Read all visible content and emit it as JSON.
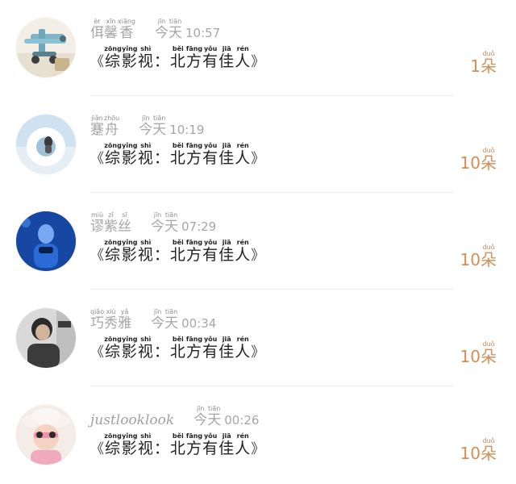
{
  "comments": [
    {
      "nickname": [
        {
          "char": "佴",
          "pinyin": "èr"
        },
        {
          "char": "馨",
          "pinyin": "xīn"
        },
        {
          "char": "香",
          "pinyin": "xiāng"
        }
      ],
      "nickname_latin": "",
      "time_word": [
        {
          "char": "今",
          "pinyin": "jīn"
        },
        {
          "char": "天",
          "pinyin": "tiān"
        }
      ],
      "time": "10:57",
      "gift_open": "《",
      "gift_chars": [
        {
          "char": "综",
          "pinyin": "zōng"
        },
        {
          "char": "影",
          "pinyin": "yǐng"
        },
        {
          "char": "视",
          "pinyin": "shì"
        },
        {
          "char": "：",
          "pinyin": ""
        },
        {
          "char": "北",
          "pinyin": "běi"
        },
        {
          "char": "方",
          "pinyin": "fāng"
        },
        {
          "char": "有",
          "pinyin": "yǒu"
        },
        {
          "char": "佳",
          "pinyin": "jiā"
        },
        {
          "char": "人",
          "pinyin": "rén"
        }
      ],
      "gift_close": "》",
      "count_num": "1",
      "count_unit": "朵",
      "count_unit_pinyin": "duǒ",
      "avatar_icon": "airplane-toy-icon"
    },
    {
      "nickname": [
        {
          "char": "蹇",
          "pinyin": "jiǎn"
        },
        {
          "char": "舟",
          "pinyin": "zhōu"
        }
      ],
      "nickname_latin": "",
      "time_word": [
        {
          "char": "今",
          "pinyin": "jīn"
        },
        {
          "char": "天",
          "pinyin": "tiān"
        }
      ],
      "time": "10:19",
      "gift_open": "《",
      "gift_chars": [
        {
          "char": "综",
          "pinyin": "zōng"
        },
        {
          "char": "影",
          "pinyin": "yǐng"
        },
        {
          "char": "视",
          "pinyin": "shì"
        },
        {
          "char": "：",
          "pinyin": ""
        },
        {
          "char": "北",
          "pinyin": "běi"
        },
        {
          "char": "方",
          "pinyin": "fāng"
        },
        {
          "char": "有",
          "pinyin": "yǒu"
        },
        {
          "char": "佳",
          "pinyin": "jiā"
        },
        {
          "char": "人",
          "pinyin": "rén"
        }
      ],
      "gift_close": "》",
      "count_num": "10",
      "count_unit": "朵",
      "count_unit_pinyin": "duǒ",
      "avatar_icon": "swim-ring-icon"
    },
    {
      "nickname": [
        {
          "char": "谬",
          "pinyin": "miù"
        },
        {
          "char": "紫",
          "pinyin": "zǐ"
        },
        {
          "char": "丝",
          "pinyin": "sī"
        }
      ],
      "nickname_latin": "",
      "time_word": [
        {
          "char": "今",
          "pinyin": "jīn"
        },
        {
          "char": "天",
          "pinyin": "tiān"
        }
      ],
      "time": "07:29",
      "gift_open": "《",
      "gift_chars": [
        {
          "char": "综",
          "pinyin": "zōng"
        },
        {
          "char": "影",
          "pinyin": "yǐng"
        },
        {
          "char": "视",
          "pinyin": "shì"
        },
        {
          "char": "：",
          "pinyin": ""
        },
        {
          "char": "北",
          "pinyin": "běi"
        },
        {
          "char": "方",
          "pinyin": "fāng"
        },
        {
          "char": "有",
          "pinyin": "yǒu"
        },
        {
          "char": "佳",
          "pinyin": "jiā"
        },
        {
          "char": "人",
          "pinyin": "rén"
        }
      ],
      "gift_close": "》",
      "count_num": "10",
      "count_unit": "朵",
      "count_unit_pinyin": "duǒ",
      "avatar_icon": "blue-portrait-icon"
    },
    {
      "nickname": [
        {
          "char": "巧",
          "pinyin": "qiǎo"
        },
        {
          "char": "秀",
          "pinyin": "xiù"
        },
        {
          "char": "雅",
          "pinyin": "yǎ"
        }
      ],
      "nickname_latin": "",
      "time_word": [
        {
          "char": "今",
          "pinyin": "jīn"
        },
        {
          "char": "天",
          "pinyin": "tiān"
        }
      ],
      "time": "00:34",
      "gift_open": "《",
      "gift_chars": [
        {
          "char": "综",
          "pinyin": "zōng"
        },
        {
          "char": "影",
          "pinyin": "yǐng"
        },
        {
          "char": "视",
          "pinyin": "shì"
        },
        {
          "char": "：",
          "pinyin": ""
        },
        {
          "char": "北",
          "pinyin": "běi"
        },
        {
          "char": "方",
          "pinyin": "fāng"
        },
        {
          "char": "有",
          "pinyin": "yǒu"
        },
        {
          "char": "佳",
          "pinyin": "jiā"
        },
        {
          "char": "人",
          "pinyin": "rén"
        }
      ],
      "gift_close": "》",
      "count_num": "10",
      "count_unit": "朵",
      "count_unit_pinyin": "duǒ",
      "avatar_icon": "person-portrait-icon"
    },
    {
      "nickname": [],
      "nickname_latin": "justlooklook",
      "time_word": [
        {
          "char": "今",
          "pinyin": "jīn"
        },
        {
          "char": "天",
          "pinyin": "tiān"
        }
      ],
      "time": "00:26",
      "gift_open": "《",
      "gift_chars": [
        {
          "char": "综",
          "pinyin": "zōng"
        },
        {
          "char": "影",
          "pinyin": "yǐng"
        },
        {
          "char": "视",
          "pinyin": "shì"
        },
        {
          "char": "：",
          "pinyin": ""
        },
        {
          "char": "北",
          "pinyin": "běi"
        },
        {
          "char": "方",
          "pinyin": "fāng"
        },
        {
          "char": "有",
          "pinyin": "yǒu"
        },
        {
          "char": "佳",
          "pinyin": "jiā"
        },
        {
          "char": "人",
          "pinyin": "rén"
        }
      ],
      "gift_close": "》",
      "count_num": "10",
      "count_unit": "朵",
      "count_unit_pinyin": "duǒ",
      "avatar_icon": "child-with-hat-icon"
    }
  ],
  "colors": {
    "accent_count": "#cf8f55",
    "meta_gray": "#a6a6a6",
    "divider": "#ececec"
  }
}
